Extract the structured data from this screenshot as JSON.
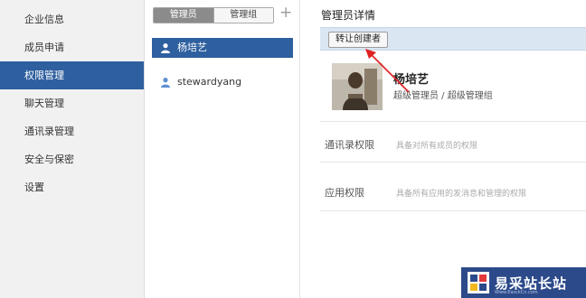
{
  "nav": {
    "items": [
      {
        "label": "企业信息",
        "active": false
      },
      {
        "label": "成员申请",
        "active": false
      },
      {
        "label": "权限管理",
        "active": true
      },
      {
        "label": "聊天管理",
        "active": false
      },
      {
        "label": "通讯录管理",
        "active": false
      },
      {
        "label": "安全与保密",
        "active": false
      },
      {
        "label": "设置",
        "active": false
      }
    ]
  },
  "list": {
    "tabs": [
      "管理员",
      "管理组"
    ],
    "active_tab": 0,
    "add_symbol": "+",
    "rows": [
      {
        "name": "杨培艺",
        "selected": true
      },
      {
        "name": "stewardyang",
        "selected": false
      }
    ]
  },
  "detail": {
    "title": "管理员详情",
    "transfer_button": "转让创建者",
    "admin_name": "杨培艺",
    "admin_role": "超级管理员 / 超级管理组",
    "permissions": [
      {
        "label": "通讯录权限",
        "desc": "具备对所有成员的权限"
      },
      {
        "label": "应用权限",
        "desc": "具备所有应用的发消息和管理的权限"
      }
    ]
  },
  "watermark": {
    "text": "易采站长站",
    "sub": "Www.EasckCn.com"
  },
  "colors": {
    "accent": "#2e5f9f",
    "annotation_arrow": "#e02020"
  }
}
